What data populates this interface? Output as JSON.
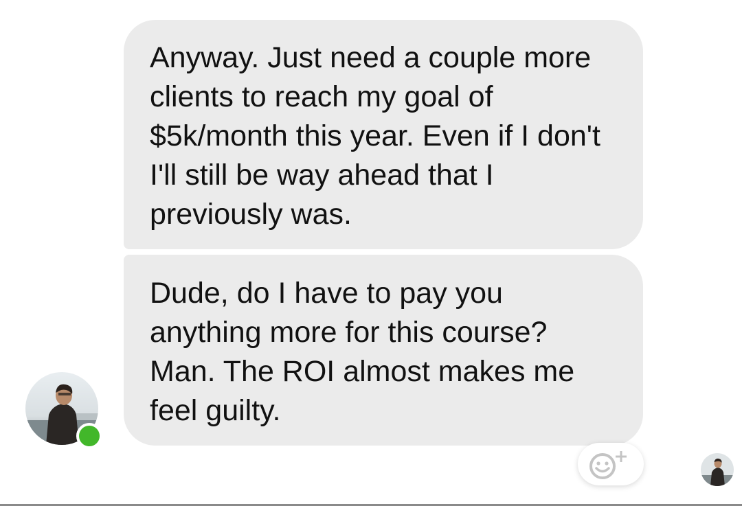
{
  "messages": [
    {
      "text": "Anyway. Just need a couple more clients to reach my goal of $5k/month this year. Even if I don't I'll still be way ahead that I previously was."
    },
    {
      "text": "Dude, do I have to pay you anything more for this course? Man. The ROI almost makes me feel guilty."
    }
  ],
  "sender": {
    "online": true,
    "online_color": "#42b72a"
  },
  "reaction_button": {
    "icon": "smiley-add-icon"
  },
  "read_receipt": {
    "icon": "seen-avatar"
  },
  "colors": {
    "bubble": "#ebebeb",
    "text": "#111111",
    "background": "#ffffff"
  }
}
